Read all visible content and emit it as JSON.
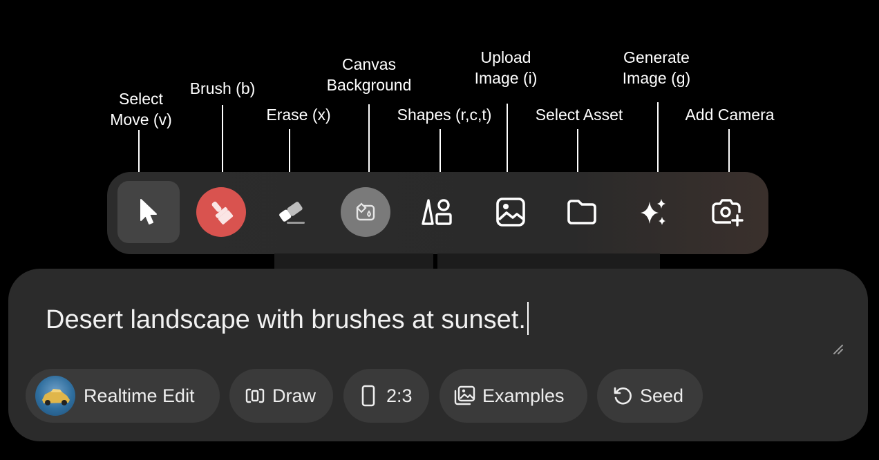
{
  "callouts": {
    "select_move": [
      "Select",
      "Move (v)"
    ],
    "brush": [
      "Brush (b)"
    ],
    "erase": [
      "Erase (x)"
    ],
    "canvas_background": [
      "Canvas",
      "Background"
    ],
    "shapes": [
      "Shapes (r,c,t)"
    ],
    "upload_image": [
      "Upload",
      "Image (i)"
    ],
    "select_asset": [
      "Select Asset"
    ],
    "generate_image": [
      "Generate",
      "Image (g)"
    ],
    "add_camera": [
      "Add Camera"
    ]
  },
  "toolbar": {
    "tools": [
      {
        "icon": "cursor-icon",
        "active": true
      },
      {
        "icon": "brush-icon",
        "color": "#d9534f"
      },
      {
        "icon": "eraser-icon"
      },
      {
        "icon": "canvas-background-icon",
        "color": "#7a7a7a"
      },
      {
        "icon": "shapes-icon"
      },
      {
        "icon": "image-icon"
      },
      {
        "icon": "folder-icon"
      },
      {
        "icon": "sparkles-icon"
      },
      {
        "icon": "camera-plus-icon"
      }
    ]
  },
  "prompt": {
    "text": "Desert landscape with brushes at sunset."
  },
  "chips": {
    "realtime_edit": "Realtime Edit",
    "draw": "Draw",
    "aspect_ratio": "2:3",
    "examples": "Examples",
    "seed": "Seed"
  },
  "colors": {
    "background": "#000000",
    "toolbar": "#2c2c2c",
    "brush_accent": "#d9534f",
    "chip": "#3a3a3a"
  }
}
